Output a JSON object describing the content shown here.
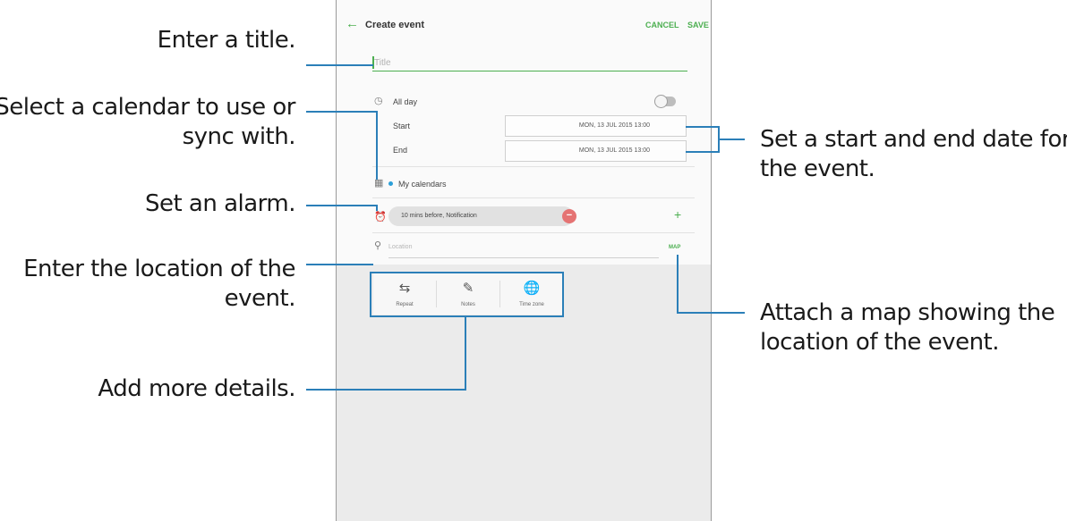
{
  "app": {
    "title": "Create event",
    "cancel_label": "CANCEL",
    "save_label": "SAVE"
  },
  "form": {
    "title_placeholder": "Title",
    "all_day_label": "All day",
    "all_day_on": false,
    "start_label": "Start",
    "start_value": "MON, 13 JUL 2015   13:00",
    "end_label": "End",
    "end_value": "MON, 13 JUL 2015   13:00",
    "calendar_label": "My calendars",
    "alarm_value": "10 mins before, Notification",
    "location_placeholder": "Location",
    "map_label": "MAP"
  },
  "details": [
    {
      "label": "Repeat",
      "icon": "repeat-icon"
    },
    {
      "label": "Notes",
      "icon": "notes-icon"
    },
    {
      "label": "Time zone",
      "icon": "time-zone-icon"
    }
  ],
  "callouts": {
    "title": [
      "Enter a title."
    ],
    "calendar": [
      "Select a calendar to use or",
      "sync with."
    ],
    "alarm": [
      "Set an alarm."
    ],
    "location": [
      "Enter the location of the",
      "event."
    ],
    "details": [
      "Add more details."
    ],
    "dates": [
      "Set a start and end date for",
      "the event."
    ],
    "map": [
      "Attach a map showing the",
      "location of the event."
    ]
  },
  "colors": {
    "accent": "#4caf50",
    "callout_line": "#2b7fb8",
    "calendar_dot": "#2b9fd8"
  }
}
